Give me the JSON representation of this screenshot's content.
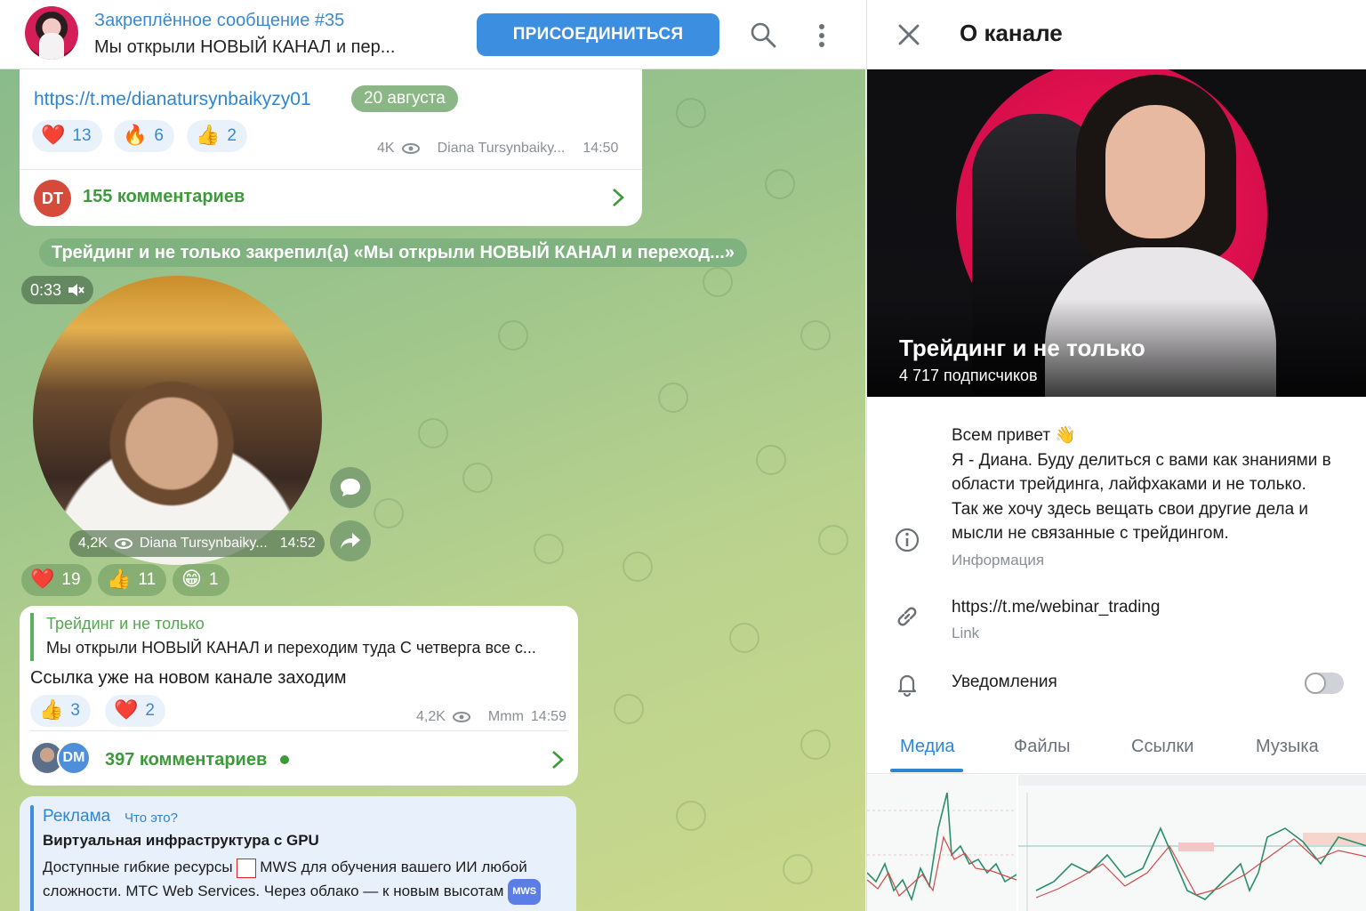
{
  "header": {
    "pinned_title": "Закреплённое сообщение #35",
    "pinned_text": "Мы открыли НОВЫЙ КАНАЛ и пер...",
    "join_label": "ПРИСОЕДИНИТЬСЯ"
  },
  "messages": {
    "first": {
      "link": "https://t.me/dianatursynbaikyzy01",
      "date": "20 августа",
      "reactions": [
        {
          "emoji": "❤️",
          "count": "13"
        },
        {
          "emoji": "🔥",
          "count": "6"
        },
        {
          "emoji": "👍",
          "count": "2"
        }
      ],
      "views": "4K",
      "author": "Diana Tursynbaiky...",
      "time": "14:50",
      "avatar_initials": "DT",
      "comments": "155 комментариев"
    },
    "service": "Трейдинг и не только закрепил(а)  «Мы открыли НОВЫЙ КАНАЛ и переход...»",
    "video": {
      "duration": "0:33",
      "views": "4,2K",
      "author": "Diana Tursynbaiky...",
      "time": "14:52",
      "reactions": [
        {
          "emoji": "❤️",
          "count": "19"
        },
        {
          "emoji": "👍",
          "count": "11"
        },
        {
          "emoji": "😁",
          "count": "1"
        }
      ]
    },
    "reply": {
      "reply_name": "Трейдинг и не только",
      "reply_text": "Мы открыли НОВЫЙ КАНАЛ и переходим туда С четверга все с...",
      "text": "Ссылка уже на новом канале заходим",
      "reactions": [
        {
          "emoji": "👍",
          "count": "3"
        },
        {
          "emoji": "❤️",
          "count": "2"
        }
      ],
      "views": "4,2K",
      "author": "Mmm",
      "time": "14:59",
      "avatar_initials": "DM",
      "comments": "397 комментариев"
    },
    "ad": {
      "label": "Реклама",
      "what": "Что это?",
      "title": "Виртуальная инфраструктура с GPU",
      "body_before": "Доступные гибкие ресурсы",
      "body_after": "MWS для обучения вашего ИИ любой сложности. МТС Web Services. Через облако — к новым высотам",
      "badge": "MWS"
    }
  },
  "panel": {
    "title": "О канале",
    "channel_name": "Трейдинг и не только",
    "subscribers": "4 717 подписчиков",
    "about": "Всем привет 👋\nЯ - Диана. Буду делиться с вами как знаниями в области трейдинга, лайфхаками и не только.\nТак же хочу здесь вещать свои другие дела и мысли не связанные с трейдингом.",
    "about_caption": "Информация",
    "link": "https://t.me/webinar_trading",
    "link_caption": "Link",
    "notifications": "Уведомления",
    "notifications_on": false,
    "tabs": [
      "Медиа",
      "Файлы",
      "Ссылки",
      "Музыка"
    ],
    "active_tab": "Медиа"
  },
  "colors": {
    "accent": "#3b8ee0",
    "green": "#3d9a3a",
    "cover_red": "#e0104f"
  }
}
